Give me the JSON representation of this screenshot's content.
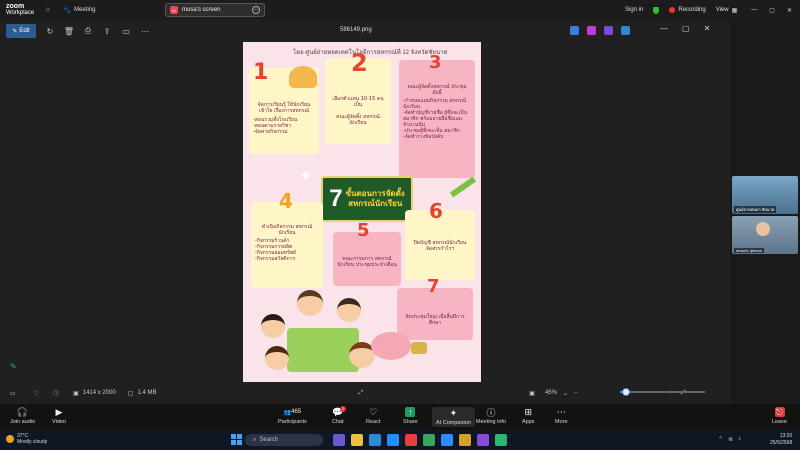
{
  "zoom": {
    "brand_line1": "zoom",
    "brand_line2": "Workplace",
    "home_label": "Home",
    "meeting_label": "Meeting",
    "shared_screen_tab": "musa's screen",
    "tab_badge": "M",
    "sign_in": "Sign in",
    "recording": "Recording",
    "view": "View"
  },
  "viewer": {
    "edit_label": "Edit",
    "file_name": "586149.png",
    "dimensions": "1414 x 2000",
    "file_size": "1.4 MB",
    "zoom_level": "45%",
    "zoom_fraction": 0.05
  },
  "poster": {
    "header": "โดย ศูนย์ถ่ายทอดเทคโนโลยีการสหกรณ์ที่ 12 จังหวัดชัยนาท",
    "title_number": "7",
    "title_line1": "ขั้นตอนการจัดตั้ง",
    "title_line2": "สหกรณ์นักเรียน",
    "steps": [
      {
        "num": "1",
        "text": "จัดการเรียนรู้ ให้นักเรียนเข้าใจ เรื่องการสหกรณ์",
        "bullets": [
          "-สอนรวมทั้งโรงเรียน",
          "-สอนตามรายวิชา",
          "-จัดค่ายกิจกรรม"
        ]
      },
      {
        "num": "2",
        "text": "เลือกตัวแทน 10-15 คนเป็น",
        "bullets": [
          "คณะผู้จัดตั้ง สหกรณ์นักเรียน"
        ]
      },
      {
        "num": "3",
        "text": "คณะผู้จัดตั้งสหกรณ์ ประชุม ดังนี้",
        "bullets": [
          "-กำหนดแผนกิจกรรม สหกรณ์นักเรียน",
          "-จัดทำบัญชีรายชื่อ ผู้ซึ่งจะเป็นสมาชิก พร้อมลายมือชื่อและ จำนวนหุ้น",
          "-ประชุมผู้ซึ่งจะเป็น สมาชิก",
          "-จัดทำร่างข้อบังคับ"
        ]
      },
      {
        "num": "4",
        "text": "ดำเนินกิจกรรม สหกรณ์นักเรียน",
        "bullets": [
          "-กิจกรรมร้านค้า",
          "-กิจกรรมการผลิต",
          "-กิจกรรมออมทรัพย์",
          "-กิจกรรมสวัสดิการ"
        ]
      },
      {
        "num": "5",
        "text": "คณะกรรมการ สหกรณ์นักเรียน ประชุมประจำเดือน",
        "bullets": []
      },
      {
        "num": "6",
        "text": "ปิดบัญชี สหกรณ์นักเรียน จัดสรรกำไรฯ",
        "bullets": []
      },
      {
        "num": "7",
        "text": "จัดประชุมใหญ่ เมื่อสิ้นปีการศึกษา",
        "bullets": []
      }
    ]
  },
  "participants": [
    {
      "name": "ศูนย์ถ่ายทอดฯ ชัยนาท"
    },
    {
      "name": "musa's Iphone"
    }
  ],
  "controls": {
    "join_audio": "Join audio",
    "video": "Video",
    "participants": "Participants",
    "participants_count": "465",
    "chat": "Chat",
    "chat_badge": "1",
    "react": "React",
    "share": "Share",
    "ai_companion": "AI Companion",
    "meeting_info": "Meeting info",
    "apps": "Apps",
    "more": "More",
    "leave": "Leave"
  },
  "taskbar": {
    "temperature": "37°C",
    "weather": "Mostly cloudy",
    "search_placeholder": "Search",
    "time": "13:20",
    "date": "25/5/2568"
  },
  "colors": {
    "accent_blue": "#2b5e8e",
    "share_green": "#1e9e5e",
    "leave_red": "#d93a3a",
    "poster_bg": "#fbe3ea",
    "title_green": "#1d5c28"
  }
}
